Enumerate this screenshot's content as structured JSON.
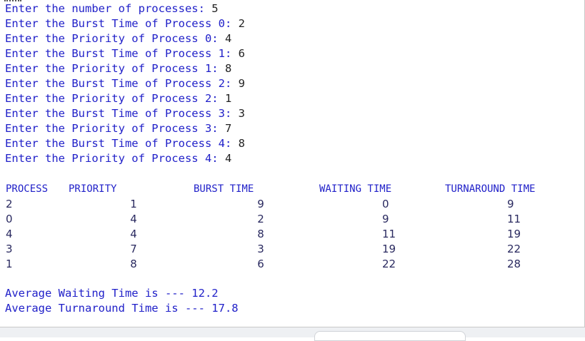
{
  "prompts": [
    {
      "label": "Enter the number of processes: ",
      "value": "5"
    },
    {
      "label": "Enter the Burst Time of Process 0: ",
      "value": "2"
    },
    {
      "label": "Enter the Priority of Process 0: ",
      "value": "4"
    },
    {
      "label": "Enter the Burst Time of Process 1: ",
      "value": "6"
    },
    {
      "label": "Enter the Priority of Process 1: ",
      "value": "8"
    },
    {
      "label": "Enter the Burst Time of Process 2: ",
      "value": "9"
    },
    {
      "label": "Enter the Priority of Process 2: ",
      "value": "1"
    },
    {
      "label": "Enter the Burst Time of Process 3: ",
      "value": "3"
    },
    {
      "label": "Enter the Priority of Process 3: ",
      "value": "7"
    },
    {
      "label": "Enter the Burst Time of Process 4: ",
      "value": "8"
    },
    {
      "label": "Enter the Priority of Process 4: ",
      "value": "4"
    }
  ],
  "table": {
    "headers": [
      "PROCESS",
      "PRIORITY",
      "BURST TIME",
      "WAITING TIME",
      "TURNAROUND TIME"
    ],
    "rows": [
      [
        "2",
        "1",
        "9",
        "0",
        "9"
      ],
      [
        "0",
        "4",
        "2",
        "9",
        "11"
      ],
      [
        "4",
        "4",
        "8",
        "11",
        "19"
      ],
      [
        "3",
        "7",
        "3",
        "19",
        "22"
      ],
      [
        "1",
        "8",
        "6",
        "22",
        "28"
      ]
    ]
  },
  "summary": [
    {
      "label": "Average Waiting Time is --- ",
      "value": "12.2"
    },
    {
      "label": "Average Turnaround Time is --- ",
      "value": "17.8"
    }
  ]
}
